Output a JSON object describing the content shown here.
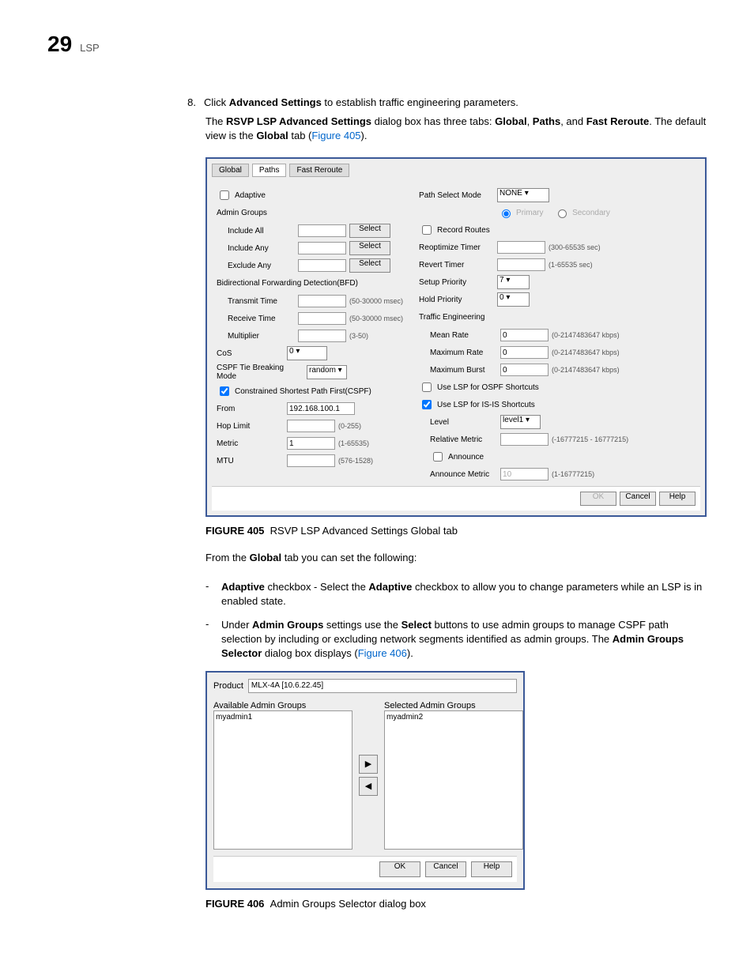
{
  "header": {
    "chapter_num": "29",
    "chapter_label": "LSP"
  },
  "step": {
    "num": "8.",
    "prefix": "Click ",
    "bold": "Advanced Settings",
    "suffix": " to establish traffic engineering parameters."
  },
  "intro": {
    "p1a": "The ",
    "p1b": "RSVP LSP Advanced Settings",
    "p1c": " dialog box has three tabs: ",
    "p1d": "Global",
    "p1e": ", ",
    "p1f": "Paths",
    "p1g": ", and ",
    "p1h": "Fast Reroute",
    "p1i": ". The default view is the ",
    "p1j": "Global",
    "p1k": " tab (",
    "p1l": "Figure 405",
    "p1m": ")."
  },
  "fig405": {
    "tabs": {
      "global": "Global",
      "paths": "Paths",
      "fast": "Fast Reroute"
    },
    "adaptive": "Adaptive",
    "admin_groups": "Admin Groups",
    "include_all": "Include All",
    "include_any": "Include Any",
    "exclude_any": "Exclude Any",
    "select": "Select",
    "bfd": "Bidirectional Forwarding Detection(BFD)",
    "transmit_time": "Transmit Time",
    "receive_time": "Receive Time",
    "multiplier": "Multiplier",
    "msec": "(50-30000 msec)",
    "mult_hint": "(3-50)",
    "cos": "CoS",
    "cos_val": "0",
    "tie_mode": "CSPF Tie Breaking Mode",
    "tie_val": "random",
    "cspf": "Constrained Shortest Path First(CSPF)",
    "from": "From",
    "from_val": "192.168.100.1",
    "hop_limit": "Hop Limit",
    "hop_hint": "(0-255)",
    "metric": "Metric",
    "metric_val": "1",
    "metric_hint": "(1-65535)",
    "mtu": "MTU",
    "mtu_hint": "(576-1528)",
    "path_select": "Path Select Mode",
    "path_select_val": "NONE",
    "primary": "Primary",
    "secondary": "Secondary",
    "record_routes": "Record Routes",
    "reopt_timer": "Reoptimize Timer",
    "reopt_hint": "(300-65535 sec)",
    "revert_timer": "Revert Timer",
    "revert_hint": "(1-65535 sec)",
    "setup_pri": "Setup Priority",
    "setup_val": "7",
    "hold_pri": "Hold Priority",
    "hold_val": "0",
    "traffic_eng": "Traffic Engineering",
    "mean_rate": "Mean Rate",
    "max_rate": "Maximum Rate",
    "max_burst": "Maximum Burst",
    "rate_val": "0",
    "rate_hint": "(0-2147483647 kbps)",
    "ospf_shortcuts": "Use LSP for OSPF Shortcuts",
    "isis_shortcuts": "Use LSP for IS-IS Shortcuts",
    "level": "Level",
    "level_val": "level1",
    "rel_metric": "Relative Metric",
    "rel_hint": "(-16777215 - 16777215)",
    "announce": "Announce",
    "announce_metric": "Announce Metric",
    "announce_val": "10",
    "announce_hint": "(1-16777215)",
    "ok": "OK",
    "cancel": "Cancel",
    "help": "Help"
  },
  "fig405_caption": {
    "label": "FIGURE 405",
    "text": "RSVP LSP Advanced Settings Global tab"
  },
  "from_global": {
    "a": "From the ",
    "b": "Global",
    "c": " tab you can set the following:"
  },
  "bullets": {
    "b1": {
      "a": "Adaptive",
      "b": " checkbox - Select the ",
      "c": "Adaptive",
      "d": " checkbox to allow you to change parameters while an LSP is in enabled state."
    },
    "b2": {
      "a": "Under ",
      "b": "Admin Groups",
      "c": " settings use the ",
      "d": "Select",
      "e": " buttons to use admin groups to manage CSPF path selection by including or excluding network segments identified as admin groups. The ",
      "f": "Admin Groups Selector",
      "g": " dialog box displays (",
      "h": "Figure 406",
      "i": ")."
    }
  },
  "fig406": {
    "product_label": "Product",
    "product_val": "MLX-4A [10.6.22.45]",
    "avail": "Available Admin Groups",
    "selected": "Selected Admin Groups",
    "item_avail": "myadmin1",
    "item_sel": "myadmin2",
    "right": "▶",
    "left": "◀",
    "ok": "OK",
    "cancel": "Cancel",
    "help": "Help"
  },
  "fig406_caption": {
    "label": "FIGURE 406",
    "text": "Admin Groups Selector dialog box"
  }
}
